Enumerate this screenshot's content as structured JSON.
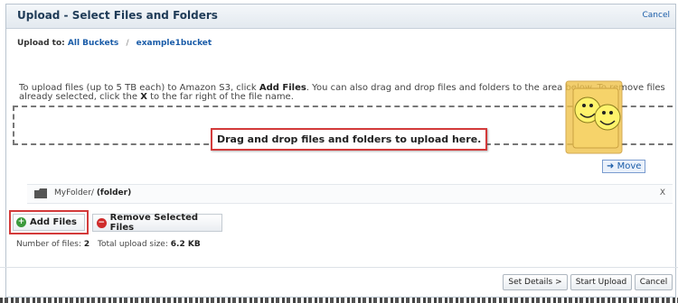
{
  "dialog": {
    "title": "Upload - Select Files and Folders",
    "cancel_link": "Cancel"
  },
  "breadcrumb": {
    "prefix": "Upload to:",
    "root": "All Buckets",
    "separator": "/",
    "bucket": "example1bucket"
  },
  "instructions": {
    "part1": "To upload files (up to 5 TB each) to Amazon S3, click ",
    "add_files": "Add Files",
    "part2": ". You can also drag and drop files and folders to the area below. To remove files already selected, click the ",
    "x": "X",
    "part3": " to the far right of the file name."
  },
  "dropzone": {
    "text": "Drag and drop files and folders to upload here."
  },
  "drag_preview": {
    "move_label": "Move",
    "icon": "smiley-folder-icon"
  },
  "files": [
    {
      "name": "MyFolder/",
      "kind": "(folder)",
      "remove": "X"
    }
  ],
  "actions": {
    "add_files": "Add Files",
    "remove_selected": "Remove Selected Files"
  },
  "stats": {
    "count_label": "Number of files:",
    "count": "2",
    "size_label": "Total upload size:",
    "size": "6.2 KB"
  },
  "footer": {
    "set_details": "Set Details >",
    "start_upload": "Start Upload",
    "cancel": "Cancel"
  },
  "colors": {
    "highlight": "#d33a3a",
    "link": "#1a5ca8",
    "add_icon": "#3c9a3c",
    "remove_icon": "#cf2b2b"
  }
}
